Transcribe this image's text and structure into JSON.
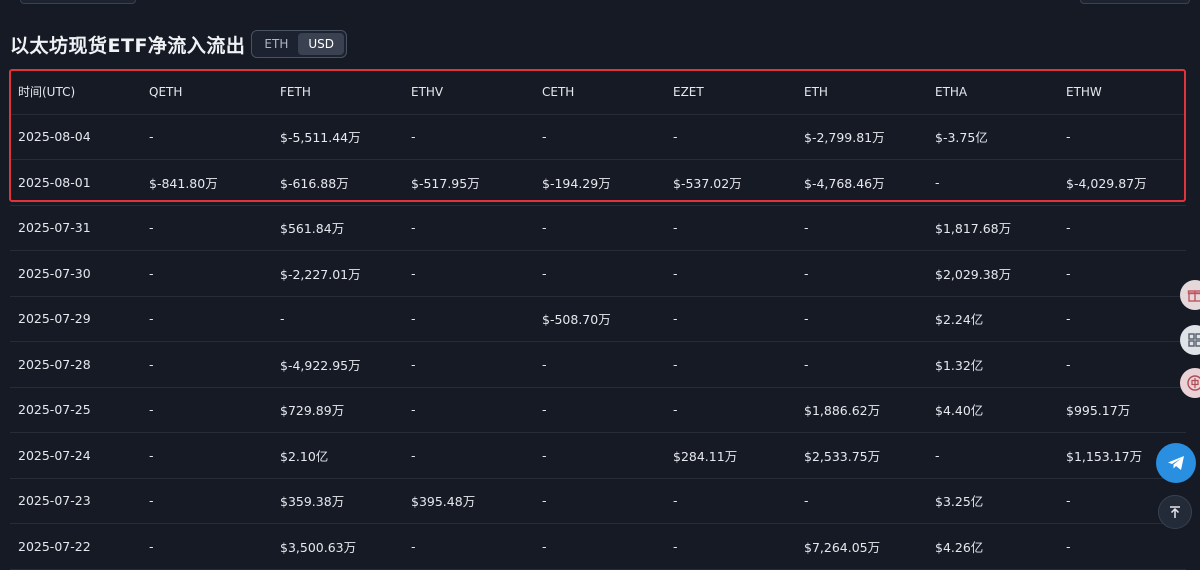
{
  "title": "以太坊现货ETF净流入流出",
  "unit_toggle": {
    "options": [
      "ETH",
      "USD"
    ],
    "selected": "USD"
  },
  "columns": [
    "时间(UTC)",
    "QETH",
    "FETH",
    "ETHV",
    "CETH",
    "EZET",
    "ETH",
    "ETHA",
    "ETHW"
  ],
  "rows": [
    {
      "date": "2025-08-04",
      "cells": [
        {
          "v": "-",
          "s": "dash"
        },
        {
          "v": "$-5,511.44万",
          "s": "neg"
        },
        {
          "v": "-",
          "s": "dash"
        },
        {
          "v": "-",
          "s": "dash"
        },
        {
          "v": "-",
          "s": "dash"
        },
        {
          "v": "$-2,799.81万",
          "s": "neg"
        },
        {
          "v": "$-3.75亿",
          "s": "neg"
        },
        {
          "v": "-",
          "s": "dash"
        }
      ]
    },
    {
      "date": "2025-08-01",
      "cells": [
        {
          "v": "$-841.80万",
          "s": "neg"
        },
        {
          "v": "$-616.88万",
          "s": "neg"
        },
        {
          "v": "$-517.95万",
          "s": "neg"
        },
        {
          "v": "$-194.29万",
          "s": "neg"
        },
        {
          "v": "$-537.02万",
          "s": "neg"
        },
        {
          "v": "$-4,768.46万",
          "s": "neg"
        },
        {
          "v": "-",
          "s": "dash"
        },
        {
          "v": "$-4,029.87万",
          "s": "neg"
        }
      ]
    },
    {
      "date": "2025-07-31",
      "cells": [
        {
          "v": "-",
          "s": "dash"
        },
        {
          "v": "$561.84万",
          "s": "pos"
        },
        {
          "v": "-",
          "s": "dash"
        },
        {
          "v": "-",
          "s": "dash"
        },
        {
          "v": "-",
          "s": "dash"
        },
        {
          "v": "-",
          "s": "dash"
        },
        {
          "v": "$1,817.68万",
          "s": "pos"
        },
        {
          "v": "-",
          "s": "dash"
        }
      ]
    },
    {
      "date": "2025-07-30",
      "cells": [
        {
          "v": "-",
          "s": "dash"
        },
        {
          "v": "$-2,227.01万",
          "s": "neg"
        },
        {
          "v": "-",
          "s": "dash"
        },
        {
          "v": "-",
          "s": "dash"
        },
        {
          "v": "-",
          "s": "dash"
        },
        {
          "v": "-",
          "s": "dash"
        },
        {
          "v": "$2,029.38万",
          "s": "pos"
        },
        {
          "v": "-",
          "s": "dash"
        }
      ]
    },
    {
      "date": "2025-07-29",
      "cells": [
        {
          "v": "-",
          "s": "dash"
        },
        {
          "v": "-",
          "s": "dash"
        },
        {
          "v": "-",
          "s": "dash"
        },
        {
          "v": "$-508.70万",
          "s": "neg"
        },
        {
          "v": "-",
          "s": "dash"
        },
        {
          "v": "-",
          "s": "dash"
        },
        {
          "v": "$2.24亿",
          "s": "pos"
        },
        {
          "v": "-",
          "s": "dash"
        }
      ]
    },
    {
      "date": "2025-07-28",
      "cells": [
        {
          "v": "-",
          "s": "dash"
        },
        {
          "v": "$-4,922.95万",
          "s": "neg"
        },
        {
          "v": "-",
          "s": "dash"
        },
        {
          "v": "-",
          "s": "dash"
        },
        {
          "v": "-",
          "s": "dash"
        },
        {
          "v": "-",
          "s": "dash"
        },
        {
          "v": "$1.32亿",
          "s": "pos"
        },
        {
          "v": "-",
          "s": "dash"
        }
      ]
    },
    {
      "date": "2025-07-25",
      "cells": [
        {
          "v": "-",
          "s": "dash"
        },
        {
          "v": "$729.89万",
          "s": "pos"
        },
        {
          "v": "-",
          "s": "dash"
        },
        {
          "v": "-",
          "s": "dash"
        },
        {
          "v": "-",
          "s": "dash"
        },
        {
          "v": "$1,886.62万",
          "s": "pos"
        },
        {
          "v": "$4.40亿",
          "s": "pos"
        },
        {
          "v": "$995.17万",
          "s": "pos"
        }
      ]
    },
    {
      "date": "2025-07-24",
      "cells": [
        {
          "v": "-",
          "s": "dash"
        },
        {
          "v": "$2.10亿",
          "s": "pos"
        },
        {
          "v": "-",
          "s": "dash"
        },
        {
          "v": "-",
          "s": "dash"
        },
        {
          "v": "$284.11万",
          "s": "pos"
        },
        {
          "v": "$2,533.75万",
          "s": "pos"
        },
        {
          "v": "-",
          "s": "dash"
        },
        {
          "v": "$1,153.17万",
          "s": "pos"
        }
      ]
    },
    {
      "date": "2025-07-23",
      "cells": [
        {
          "v": "-",
          "s": "dash"
        },
        {
          "v": "$359.38万",
          "s": "pos"
        },
        {
          "v": "$395.48万",
          "s": "pos"
        },
        {
          "v": "-",
          "s": "dash"
        },
        {
          "v": "-",
          "s": "dash"
        },
        {
          "v": "-",
          "s": "dash"
        },
        {
          "v": "$3.25亿",
          "s": "pos"
        },
        {
          "v": "-",
          "s": "dash"
        }
      ]
    },
    {
      "date": "2025-07-22",
      "cells": [
        {
          "v": "-",
          "s": "dash"
        },
        {
          "v": "$3,500.63万",
          "s": "pos"
        },
        {
          "v": "-",
          "s": "dash"
        },
        {
          "v": "-",
          "s": "dash"
        },
        {
          "v": "-",
          "s": "dash"
        },
        {
          "v": "$7,264.05万",
          "s": "pos"
        },
        {
          "v": "$4.26亿",
          "s": "pos"
        },
        {
          "v": "-",
          "s": "dash"
        }
      ]
    }
  ],
  "colors": {
    "negative": "#f0475a",
    "positive": "#40c07a",
    "highlight": "#e0343b",
    "background": "#151a24"
  },
  "side_buttons": [
    "gift-icon",
    "grid-icon",
    "language-icon",
    "telegram-icon",
    "back-to-top-icon"
  ]
}
